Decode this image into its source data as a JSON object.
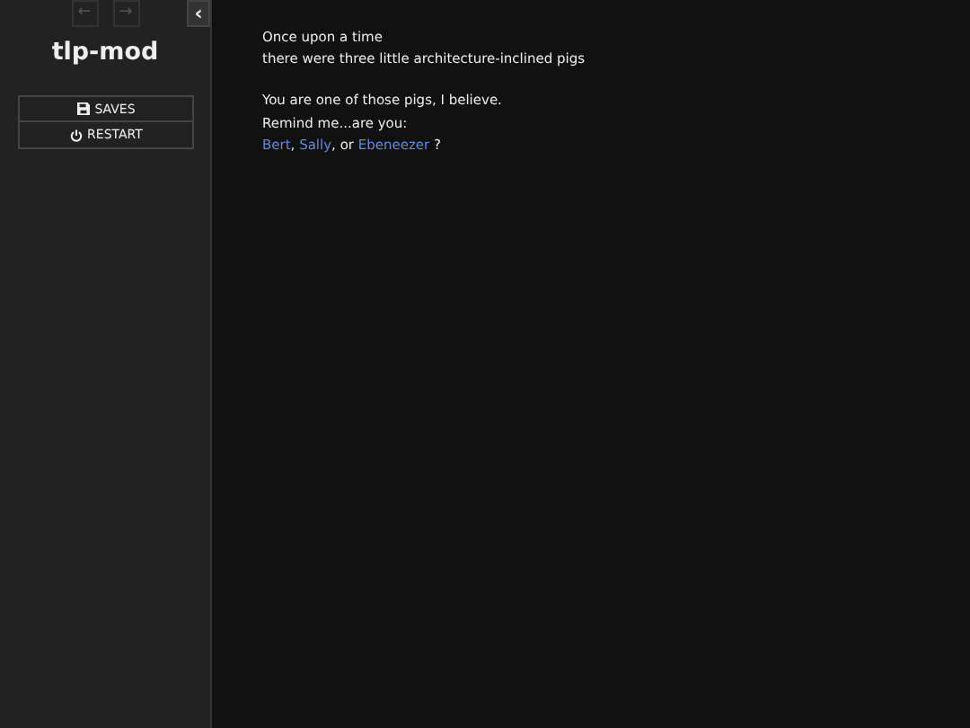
{
  "sidebar": {
    "history_buttons": [
      {
        "symbol": "←",
        "disabled": true
      },
      {
        "symbol": "→",
        "disabled": true
      }
    ],
    "collapse_button": {
      "symbol": "‹"
    },
    "story_title": "tlp-mod",
    "menu": [
      {
        "kind": "saves",
        "label": "SAVES"
      },
      {
        "kind": "restart",
        "label": "RESTART"
      }
    ]
  },
  "passage": {
    "paragraphs": [
      [
        [
          {
            "kind": "text",
            "text": "Once upon a time"
          }
        ],
        [
          {
            "kind": "text",
            "text": "there were three little architecture-inclined pigs"
          }
        ]
      ],
      [
        [
          {
            "kind": "text",
            "text": "You are one of those pigs, I believe."
          }
        ],
        [
          {
            "kind": "text",
            "text": "Remind me...are you:"
          }
        ],
        [
          {
            "kind": "link",
            "text": "Bert"
          },
          {
            "kind": "text",
            "text": ", "
          },
          {
            "kind": "link",
            "text": "Sally"
          },
          {
            "kind": "text",
            "text": ", or "
          },
          {
            "kind": "link",
            "text": "Ebeneezer"
          },
          {
            "kind": "text",
            "text": " ?"
          }
        ]
      ]
    ]
  }
}
